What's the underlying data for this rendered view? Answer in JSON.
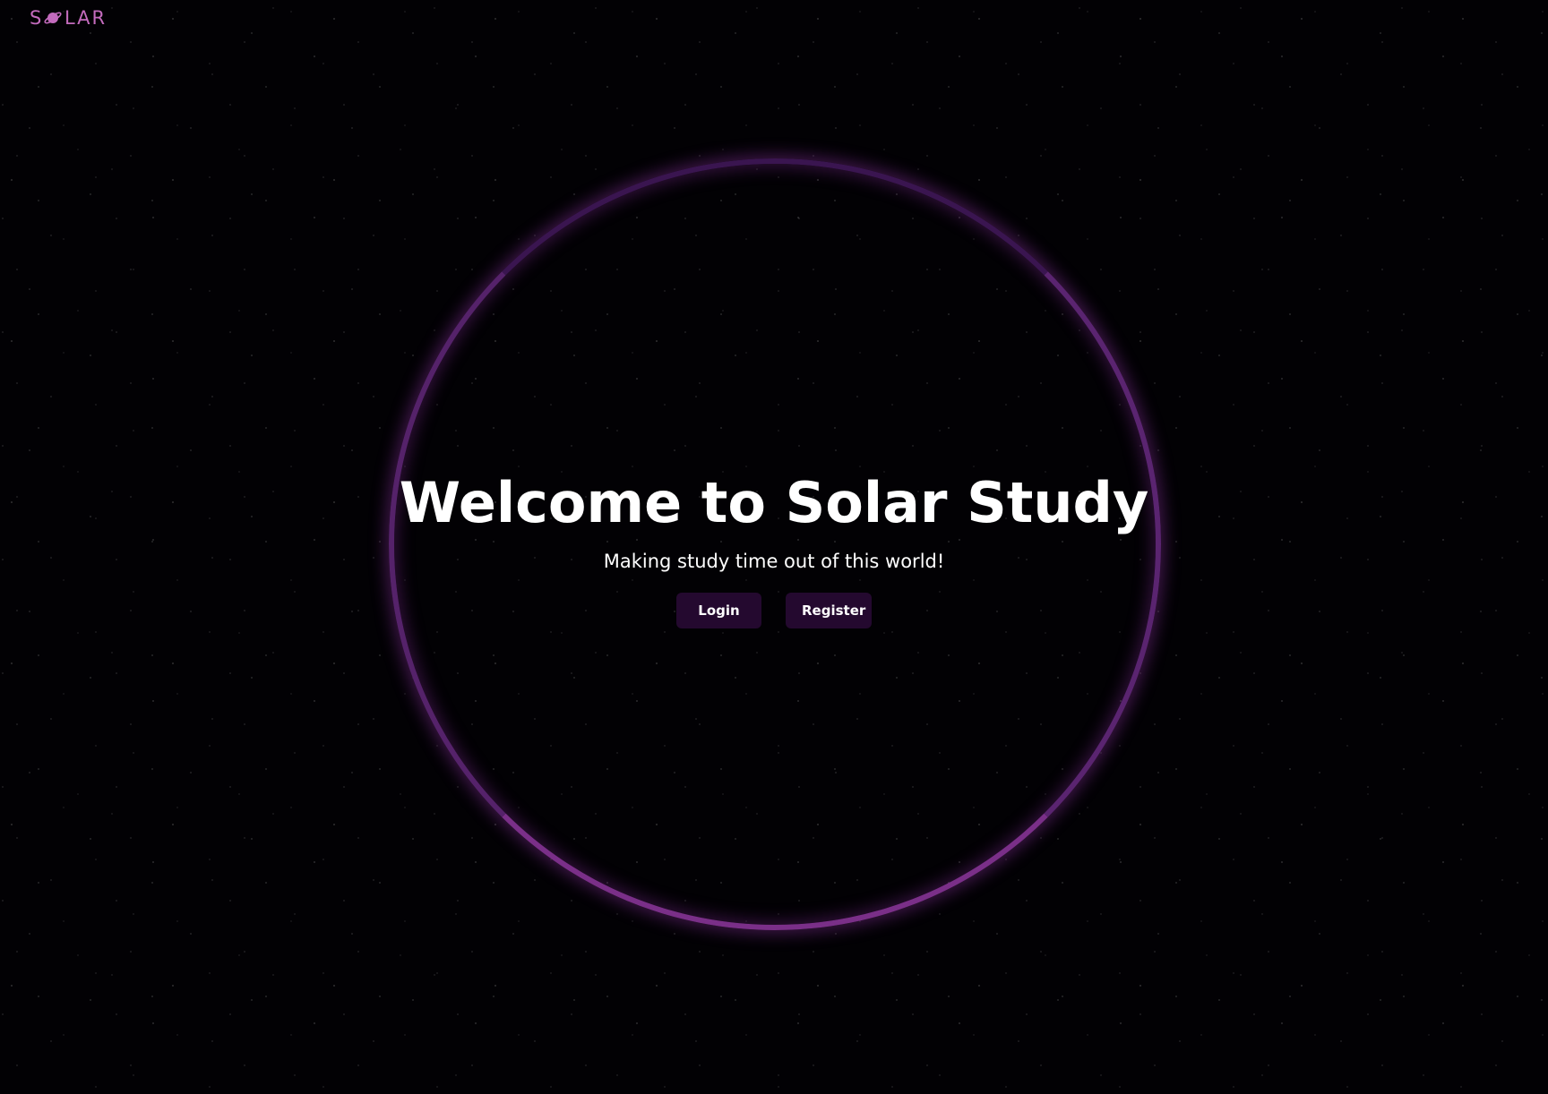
{
  "header": {
    "logo_text": "S LAR",
    "logo_icon": "planet-icon",
    "logo_color": "#c36bbd"
  },
  "hero": {
    "title": "Welcome to Solar Study",
    "subtitle": "Making study time out of this world!"
  },
  "actions": {
    "login_label": "Login",
    "register_label": "Register",
    "button_color": "#24092f"
  },
  "theme": {
    "background": "#000000",
    "ring_color": "#7a2f88"
  }
}
